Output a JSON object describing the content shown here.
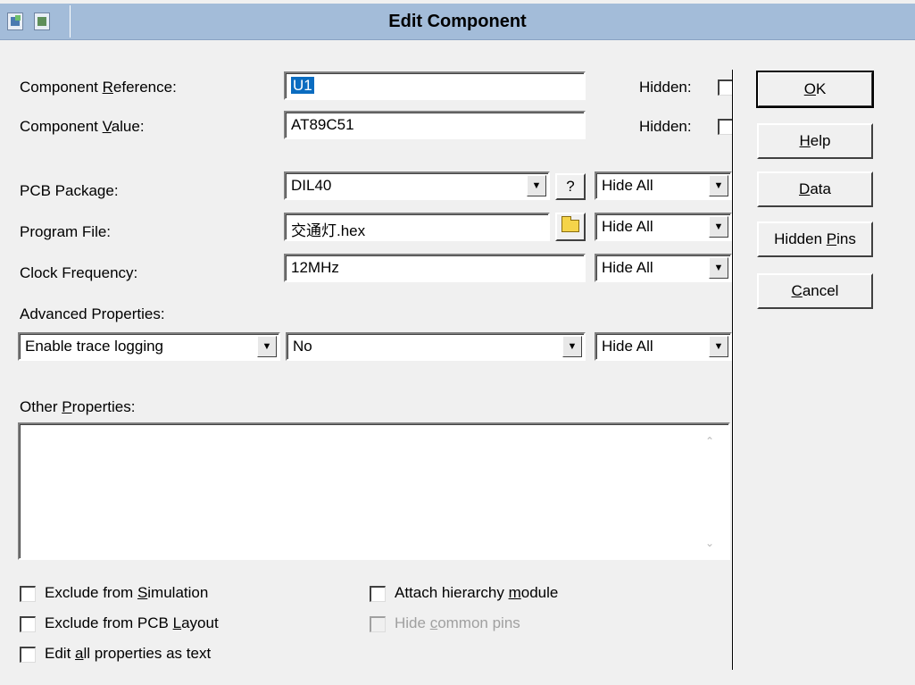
{
  "window": {
    "title": "Edit Component"
  },
  "fields": {
    "component_reference": {
      "label_pre": "Component ",
      "label_key": "R",
      "label_post": "eference:",
      "value": "U1",
      "hidden_label": "Hidden:"
    },
    "component_value": {
      "label_pre": "Component ",
      "label_key": "V",
      "label_post": "alue:",
      "value": "AT89C51",
      "hidden_label": "Hidden:"
    },
    "pcb_package": {
      "label": "PCB Package:",
      "value": "DIL40",
      "help_glyph": "?",
      "visibility": "Hide All"
    },
    "program_file": {
      "label": "Program File:",
      "value": "交通灯.hex",
      "visibility": "Hide All"
    },
    "clock_frequency": {
      "label": "Clock Frequency:",
      "value": "12MHz",
      "visibility": "Hide All"
    }
  },
  "advanced": {
    "label": "Advanced Properties:",
    "property": "Enable trace logging",
    "value": "No",
    "visibility": "Hide All"
  },
  "other_properties": {
    "label_pre": "Other ",
    "label_key": "P",
    "label_post": "roperties:",
    "value": ""
  },
  "checkboxes": {
    "exclude_sim": {
      "pre": "Exclude from ",
      "key": "S",
      "post": "imulation"
    },
    "exclude_pcb": {
      "pre": "Exclude from PCB ",
      "key": "L",
      "post": "ayout"
    },
    "edit_text": {
      "pre": "Edit ",
      "key": "a",
      "post": "ll properties as text"
    },
    "attach_hier": {
      "pre": "Attach hierarchy ",
      "key": "m",
      "post": "odule"
    },
    "hide_common": {
      "pre": "Hide ",
      "key": "c",
      "post": "ommon pins"
    }
  },
  "buttons": {
    "ok": {
      "key": "O",
      "post": "K"
    },
    "help": {
      "key": "H",
      "post": "elp"
    },
    "data": {
      "key": "D",
      "post": "ata"
    },
    "hidden_pins": {
      "pre": "Hidden ",
      "key": "P",
      "post": "ins"
    },
    "cancel": {
      "key": "C",
      "post": "ancel"
    }
  },
  "icons": {
    "dropdown": "chevron-down-icon",
    "browse": "folder-icon",
    "app": "component-icon"
  }
}
